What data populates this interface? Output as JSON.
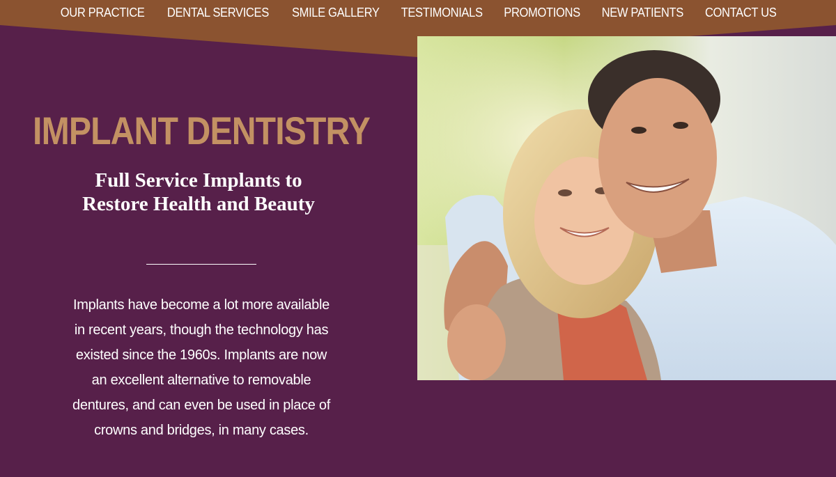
{
  "nav": {
    "items": [
      {
        "label": "OUR PRACTICE",
        "id": "our-practice"
      },
      {
        "label": "DENTAL SERVICES",
        "id": "dental-services"
      },
      {
        "label": "SMILE GALLERY",
        "id": "smile-gallery"
      },
      {
        "label": "TESTIMONIALS",
        "id": "testimonials"
      },
      {
        "label": "PROMOTIONS",
        "id": "promotions"
      },
      {
        "label": "NEW PATIENTS",
        "id": "new-patients"
      },
      {
        "label": "CONTACT US",
        "id": "contact-us"
      }
    ]
  },
  "hero": {
    "title": "IMPLANT DENTISTRY",
    "subtitle": "Full Service Implants to Restore Health and Beauty",
    "body": "Implants have become a lot more available in recent years, though the technology has existed since the 1960s. Implants are now an excellent alternative to removable dentures, and can even be used in place of crowns and bridges, in many cases."
  },
  "colors": {
    "background": "#57204a",
    "nav_band": "#8b5330",
    "title": "#c39163"
  }
}
